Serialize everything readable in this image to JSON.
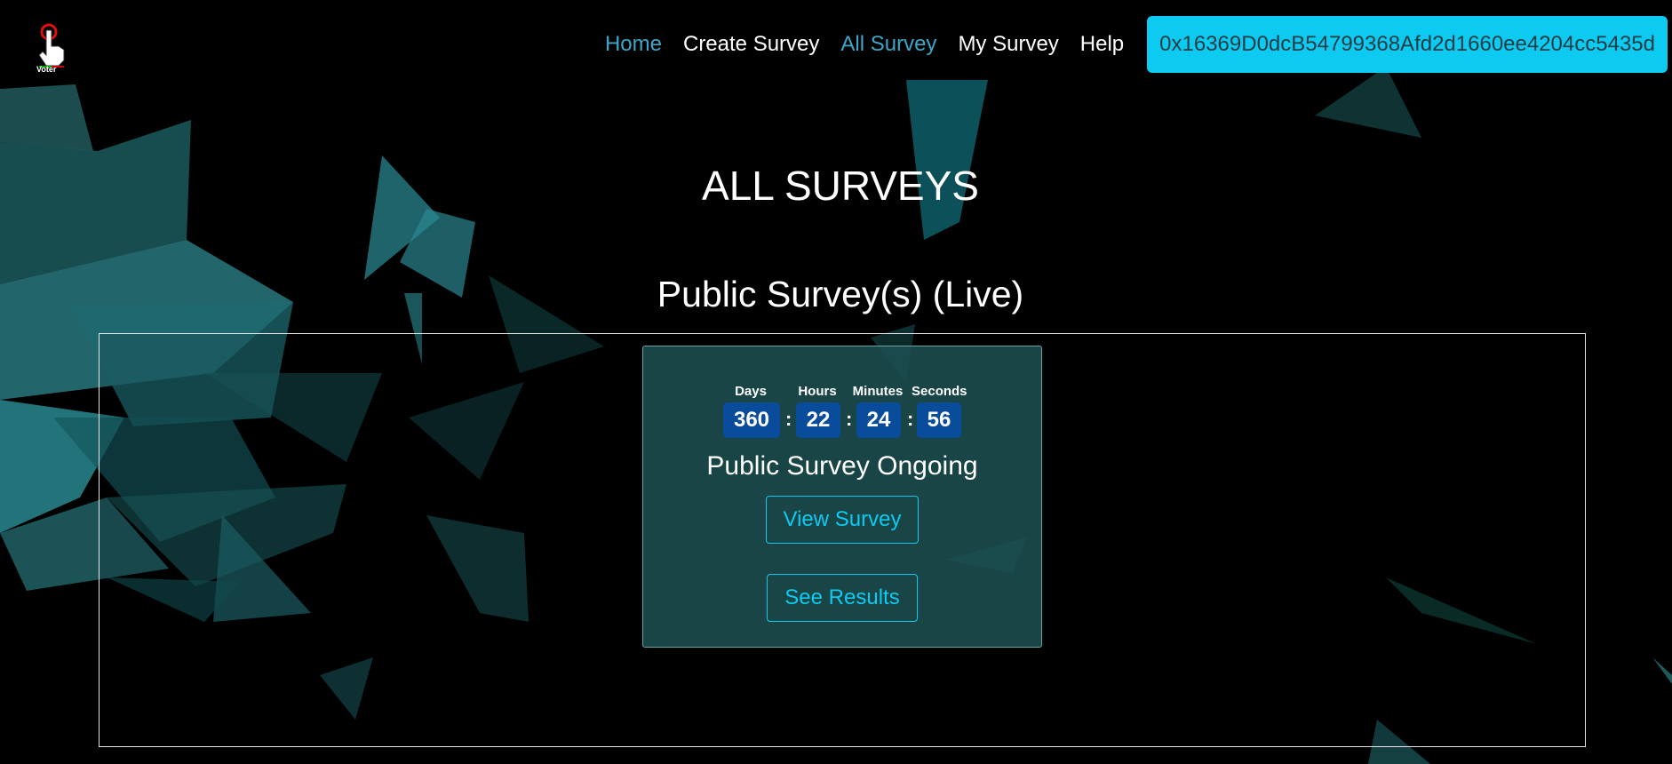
{
  "nav": {
    "logo_icon": "voter-hand-pointer-icon",
    "logo_text": "Voter",
    "items": [
      {
        "label": "Home",
        "active": true
      },
      {
        "label": "Create Survey",
        "active": false
      },
      {
        "label": "All Survey",
        "active": true
      },
      {
        "label": "My Survey",
        "active": false
      },
      {
        "label": "Help",
        "active": false
      }
    ],
    "wallet_address": "0x16369D0dcB54799368Afd2d1660ee4204cc5435d"
  },
  "page": {
    "title": "ALL SURVEYS",
    "section_title": "Public Survey(s) (Live)"
  },
  "survey_card": {
    "countdown": {
      "days_label": "Days",
      "hours_label": "Hours",
      "minutes_label": "Minutes",
      "seconds_label": "Seconds",
      "days": "360",
      "hours": "22",
      "minutes": "24",
      "seconds": "56",
      "separator": ":"
    },
    "status": "Public Survey Ongoing",
    "view_button": "View Survey",
    "results_button": "See Results"
  },
  "colors": {
    "background": "#000000",
    "accent": "#0dcaf0",
    "active_link": "#3aa7c9",
    "card": "#1c4e50",
    "countdown_box": "#0a4c9c"
  }
}
